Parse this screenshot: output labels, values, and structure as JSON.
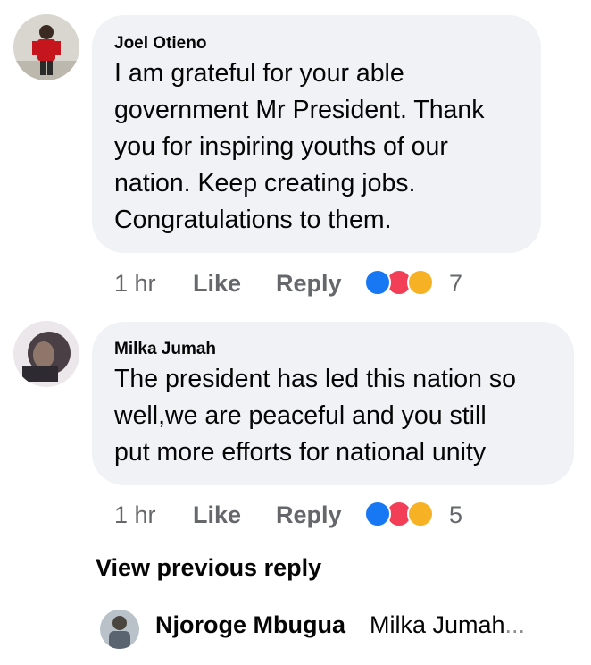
{
  "comments": [
    {
      "author": "Joel Otieno",
      "lines": [
        "I am grateful for  your able",
        "government Mr President. Thank",
        "you for inspiring youths of our",
        "nation.  Keep creating jobs.",
        "Congratulations to them."
      ],
      "time": "1 hr",
      "like_label": "Like",
      "reply_label": "Reply",
      "reaction_count": "7",
      "reactions": [
        "like-icon",
        "love-icon",
        "care-icon"
      ]
    },
    {
      "author": "Milka Jumah",
      "lines": [
        "The president has led this nation so",
        "well,we are peaceful and you still",
        "put more efforts for national unity"
      ],
      "time": "1 hr",
      "like_label": "Like",
      "reply_label": "Reply",
      "reaction_count": "5",
      "reactions": [
        "like-icon",
        "love-icon",
        "care-icon"
      ]
    }
  ],
  "view_previous": "View previous reply",
  "latest_reply": {
    "author": "Njoroge Mbugua",
    "preview": "Milka Jumah",
    "ellipsis": "..."
  },
  "colors": {
    "bubble": "#f0f2f5",
    "meta_text": "#65676b",
    "like_blue": "#1877f2",
    "love_red": "#f33e58",
    "care_yellow": "#f7b125"
  }
}
